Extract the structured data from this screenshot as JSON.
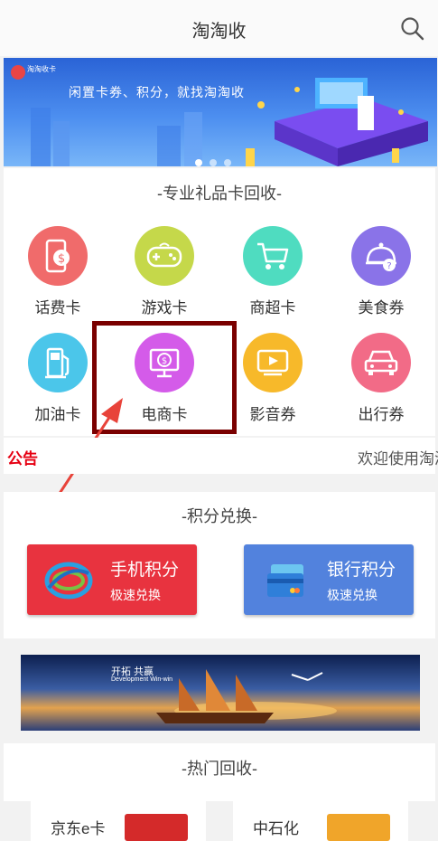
{
  "header": {
    "title": "淘淘收"
  },
  "banner": {
    "logo_text": "淘淘收卡",
    "tagline": "闲置卡券、积分，就找淘淘收"
  },
  "gift_section": {
    "title": "-专业礼品卡回收-",
    "items": [
      {
        "label": "话费卡",
        "icon": "phone-card-icon",
        "color": "#f06b6b"
      },
      {
        "label": "游戏卡",
        "icon": "gamepad-icon",
        "color": "#c5d84a"
      },
      {
        "label": "商超卡",
        "icon": "shopping-cart-icon",
        "color": "#4fdcc0"
      },
      {
        "label": "美食券",
        "icon": "food-cover-icon",
        "color": "#8a73e8"
      },
      {
        "label": "加油卡",
        "icon": "fuel-pump-icon",
        "color": "#4bc6ea"
      },
      {
        "label": "电商卡",
        "icon": "monitor-coin-icon",
        "color": "#d45be9"
      },
      {
        "label": "影音券",
        "icon": "video-player-icon",
        "color": "#f7b92a"
      },
      {
        "label": "出行券",
        "icon": "car-icon",
        "color": "#f26b87"
      }
    ]
  },
  "notice": {
    "tag": "公告",
    "text": "欢迎使用淘淘"
  },
  "points_section": {
    "title": "-积分兑换-",
    "cards": [
      {
        "title": "手机积分",
        "subtitle": "极速兑换",
        "color": "#e8333f"
      },
      {
        "title": "银行积分",
        "subtitle": "极速兑换",
        "color": "#5282dd"
      }
    ]
  },
  "banner2": {
    "title": "开拓 共赢",
    "subtitle": "Development Win-win"
  },
  "hot_section": {
    "title": "-热门回收-",
    "items": [
      {
        "name": "京东e卡",
        "color": "#d42a2a"
      },
      {
        "name": "中石化",
        "color": "#f0a52a"
      }
    ]
  }
}
